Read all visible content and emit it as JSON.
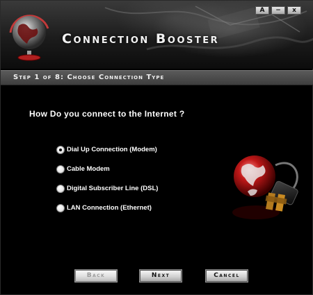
{
  "window": {
    "title": "Connection Booster",
    "controls": {
      "help": "A",
      "minimize": "−",
      "close": "x"
    }
  },
  "step_bar": {
    "text": "Step 1  of 8: Choose Connection Type"
  },
  "question": "How Do you connect to the Internet ?",
  "options": [
    {
      "label": "Dial Up Connection (Modem)",
      "selected": true
    },
    {
      "label": "Cable Modem",
      "selected": false
    },
    {
      "label": "Digital Subscriber Line (DSL)",
      "selected": false
    },
    {
      "label": "LAN Connection (Ethernet)",
      "selected": false
    }
  ],
  "buttons": {
    "back": "Back",
    "next": "Next",
    "cancel": "Cancel"
  },
  "colors": {
    "background": "#000000",
    "globe_red": "#b01818",
    "header_gray": "#2a2a2a",
    "step_bar": "#4a4a4a"
  },
  "icons": {
    "logo": "globe-stand-icon",
    "side_art": "globe-plug-icon"
  }
}
